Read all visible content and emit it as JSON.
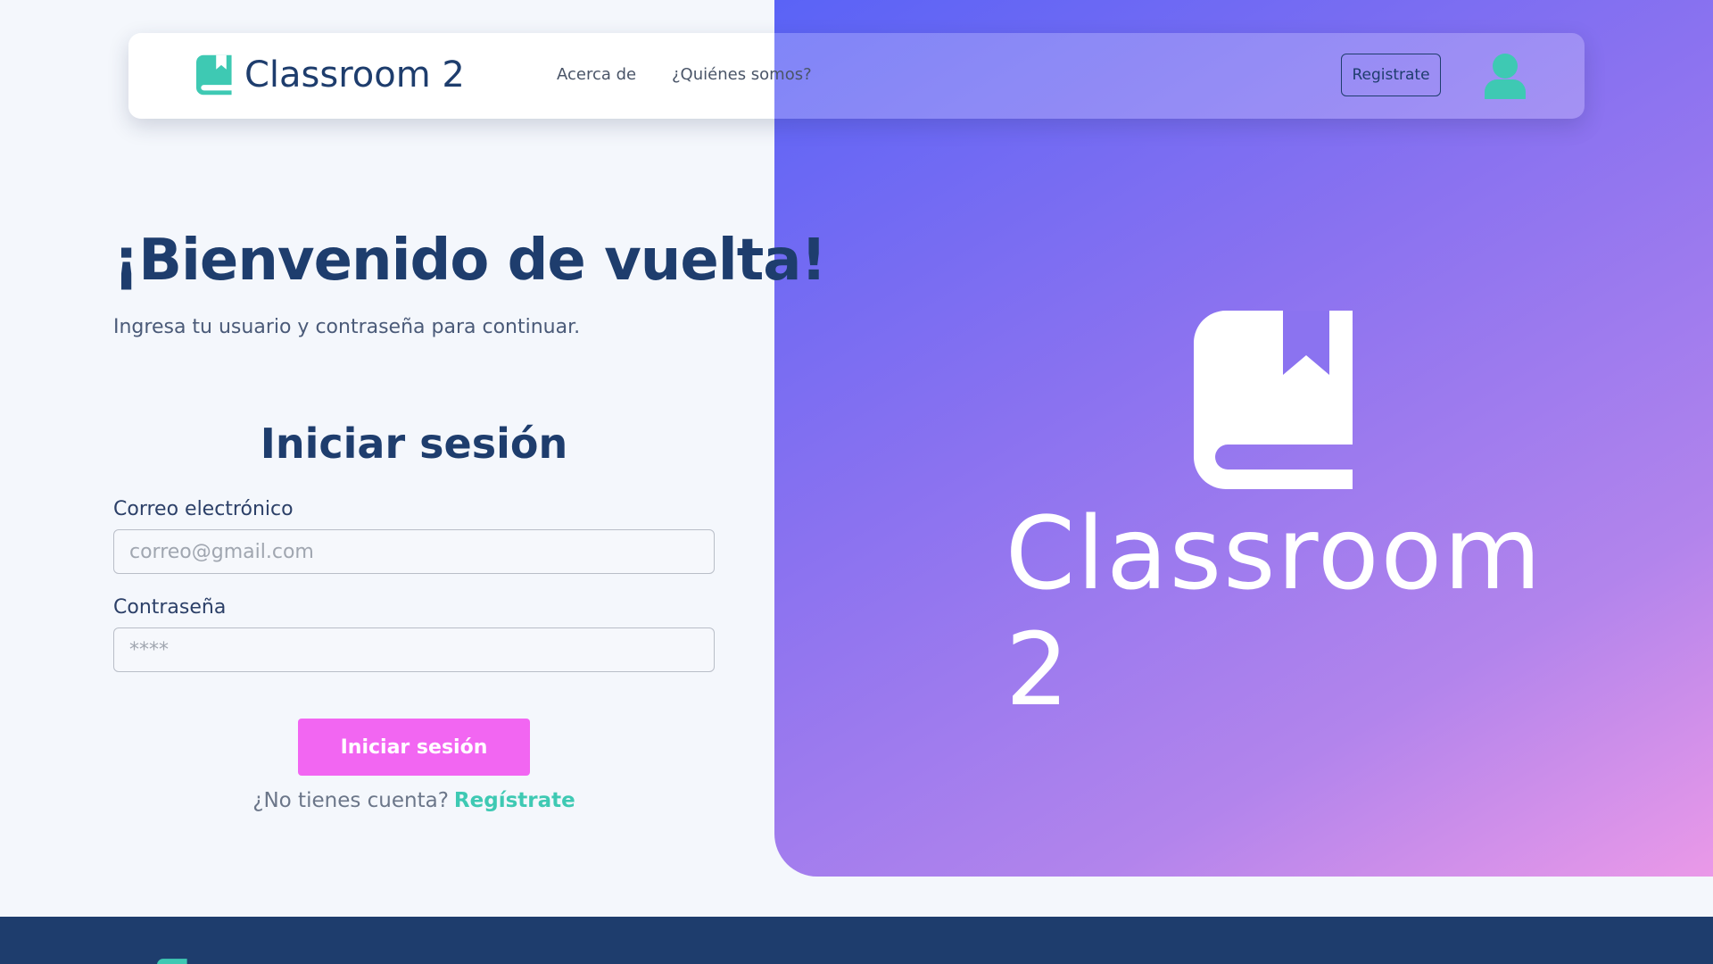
{
  "navbar": {
    "brand_name": "Classroom 2",
    "links": [
      "Acerca de",
      "¿Quiénes somos?"
    ],
    "register_label": "Registrate"
  },
  "login": {
    "welcome_title": "¡Bienvenido de vuelta!",
    "subtitle": "Ingresa tu usuario y contraseña para continuar.",
    "form_title": "Iniciar sesión",
    "email_label": "Correo electrónico",
    "email_placeholder": "correo@gmail.com",
    "password_label": "Contraseña",
    "password_placeholder": "****",
    "submit_label": "Iniciar sesión",
    "no_account_text": "¿No tienes cuenta?",
    "register_link": "Regístrate"
  },
  "hero": {
    "brand_name": "Classroom 2"
  },
  "colors": {
    "primary_dark": "#1e3d6d",
    "accent_teal": "#3ec9b3",
    "button_pink": "#f266f2",
    "gradient_start": "#5a63f6",
    "gradient_end": "#ea99e8"
  },
  "icons": {
    "brand": "book-bookmark-icon",
    "avatar": "user-icon"
  }
}
